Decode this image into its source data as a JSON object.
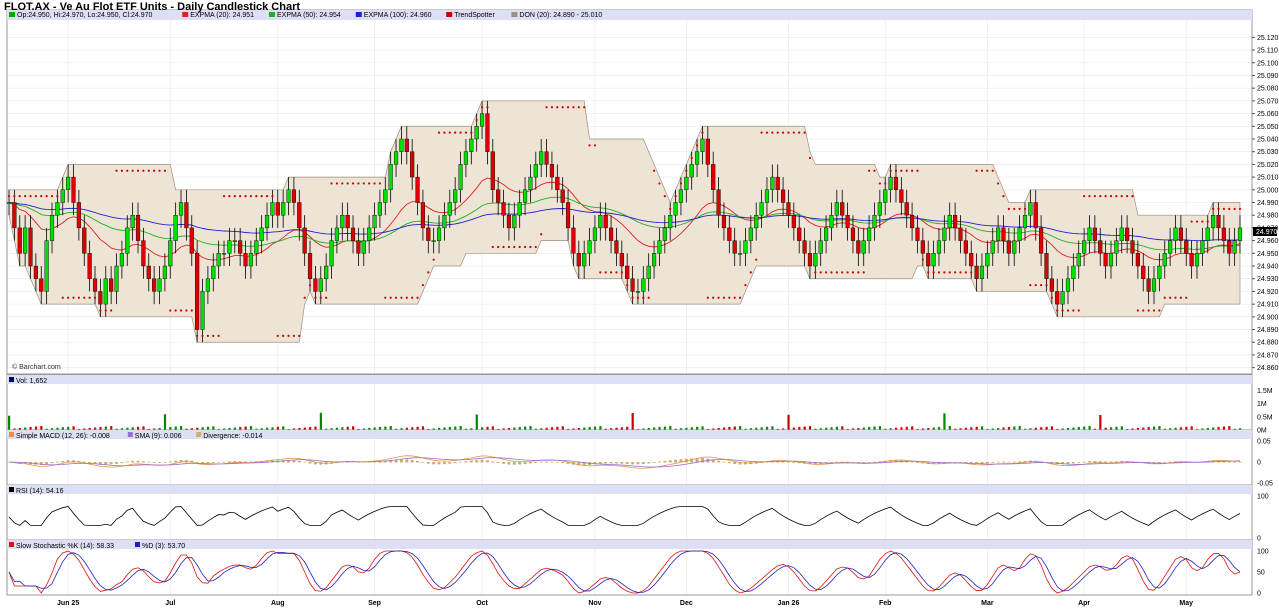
{
  "title": "FLOT.AX - Ve Au Flot ETF Units - Daily Candlestick Chart",
  "watermark": "© Barchart.com",
  "colors": {
    "up": "#00dd00",
    "down": "#dd0000",
    "ema20": "#e02020",
    "ema50": "#20b020",
    "ema100": "#2020d0",
    "donchian_fill": "#ede4d6",
    "donchian_line": "#a09080",
    "trendspotter": "#cc0000",
    "header_bg": "#dde0f4",
    "grid": "#e8e8e8",
    "macd_line": "#e8904c",
    "macd_signal": "#9a70d0",
    "macd_hist": "#c8b070",
    "rsi_line": "#000000",
    "stoch_k": "#e01010",
    "stoch_d": "#2020c0"
  },
  "legends": {
    "price": [
      {
        "label": "Op:24.950, Hi:24.970, Lo:24.950, Cl:24.970",
        "color": "#00aa00"
      },
      {
        "label": "EXPMA (20): 24.951",
        "color": "#e02020"
      },
      {
        "label": "EXPMA (50): 24.954",
        "color": "#20b020"
      },
      {
        "label": "EXPMA (100): 24.960",
        "color": "#2020d0"
      },
      {
        "label": "TrendSpotter",
        "color": "#cc0000"
      },
      {
        "label": "DON (20): 24.890 - 25.010",
        "color": "#a09080"
      }
    ],
    "volume": "Vol: 1,652",
    "macd": [
      "Simple MACD (12, 26): -0.008",
      "SMA (9): 0.006",
      "Divergence: -0.014"
    ],
    "rsi": "RSI (14): 54.16",
    "stoch": [
      "Slow Stochastic %K (14): 58.33",
      "%D (3): 53.70"
    ]
  },
  "last_price_tag": "24.970",
  "axes": {
    "price_ticks": [
      "25.120",
      "25.110",
      "25.100",
      "25.090",
      "25.080",
      "25.070",
      "25.060",
      "25.050",
      "25.040",
      "25.030",
      "25.020",
      "25.010",
      "25.000",
      "24.990",
      "24.980",
      "24.970",
      "24.960",
      "24.950",
      "24.940",
      "24.930",
      "24.920",
      "24.910",
      "24.900",
      "24.890",
      "24.880",
      "24.870",
      "24.860"
    ],
    "volume_ticks": [
      "1.5M",
      "1M",
      "0.5M",
      "0M"
    ],
    "macd_ticks": [
      "0.05",
      "0",
      "-0.05"
    ],
    "rsi_ticks": [
      "100",
      "0"
    ],
    "stoch_ticks": [
      "100",
      "50",
      "0"
    ],
    "months": [
      "Jun 25",
      "Jul",
      "Aug",
      "Sep",
      "Oct",
      "Nov",
      "Dec",
      "Jan 26",
      "Feb",
      "Mar",
      "Apr",
      "May"
    ]
  },
  "chart_data": {
    "type": "candlestick",
    "title": "FLOT.AX - Ve Au Flot ETF Units - Daily Candlestick Chart",
    "ylim": [
      24.855,
      25.125
    ],
    "last": {
      "open": 24.95,
      "high": 24.97,
      "low": 24.95,
      "close": 24.97
    },
    "close_series": [
      24.99,
      24.97,
      24.95,
      24.97,
      24.94,
      24.93,
      24.92,
      24.96,
      24.98,
      24.99,
      25.0,
      25.01,
      24.99,
      24.97,
      24.95,
      24.93,
      24.92,
      24.91,
      24.93,
      24.92,
      24.94,
      24.95,
      24.97,
      24.98,
      24.96,
      24.94,
      24.93,
      24.92,
      24.93,
      24.94,
      24.96,
      24.98,
      24.99,
      24.97,
      24.95,
      24.89,
      24.92,
      24.93,
      24.94,
      24.95,
      24.95,
      24.96,
      24.96,
      24.95,
      24.94,
      24.95,
      24.96,
      24.97,
      24.98,
      24.99,
      24.98,
      24.99,
      25.0,
      24.99,
      24.97,
      24.95,
      24.93,
      24.92,
      24.93,
      24.94,
      24.96,
      24.97,
      24.98,
      24.97,
      24.96,
      24.95,
      24.96,
      24.97,
      24.98,
      24.99,
      25.0,
      25.02,
      25.03,
      25.04,
      25.03,
      25.01,
      24.99,
      24.97,
      24.96,
      24.96,
      24.97,
      24.98,
      24.99,
      25.0,
      25.02,
      25.03,
      25.04,
      25.05,
      25.06,
      25.03,
      25.0,
      24.99,
      24.98,
      24.97,
      24.98,
      24.99,
      25.0,
      25.01,
      25.02,
      25.03,
      25.02,
      25.01,
      25.0,
      24.99,
      24.97,
      24.95,
      24.94,
      24.95,
      24.96,
      24.97,
      24.98,
      24.97,
      24.96,
      24.95,
      24.94,
      24.93,
      24.92,
      24.92,
      24.93,
      24.94,
      24.95,
      24.96,
      24.97,
      24.98,
      24.99,
      25.0,
      25.01,
      25.02,
      25.03,
      25.04,
      25.02,
      25.0,
      24.98,
      24.97,
      24.96,
      24.95,
      24.95,
      24.96,
      24.97,
      24.98,
      24.99,
      25.0,
      25.01,
      25.0,
      24.99,
      24.98,
      24.97,
      24.96,
      24.95,
      24.94,
      24.95,
      24.96,
      24.97,
      24.98,
      24.99,
      24.98,
      24.97,
      24.96,
      24.95,
      24.96,
      24.97,
      24.98,
      24.99,
      25.0,
      25.01,
      25.0,
      24.99,
      24.98,
      24.97,
      24.96,
      24.95,
      24.94,
      24.95,
      24.96,
      24.97,
      24.98,
      24.97,
      24.96,
      24.95,
      24.94,
      24.93,
      24.94,
      24.95,
      24.96,
      24.97,
      24.96,
      24.95,
      24.96,
      24.97,
      24.98,
      24.99,
      24.97,
      24.95,
      24.93,
      24.92,
      24.91,
      24.92,
      24.93,
      24.94,
      24.95,
      24.96,
      24.97,
      24.96,
      24.95,
      24.94,
      24.95,
      24.96,
      24.97,
      24.96,
      24.95,
      24.94,
      24.93,
      24.92,
      24.93,
      24.94,
      24.95,
      24.96,
      24.97,
      24.96,
      24.95,
      24.94,
      24.95,
      24.96,
      24.97,
      24.98,
      24.97,
      24.96,
      24.95,
      24.96,
      24.97
    ]
  }
}
